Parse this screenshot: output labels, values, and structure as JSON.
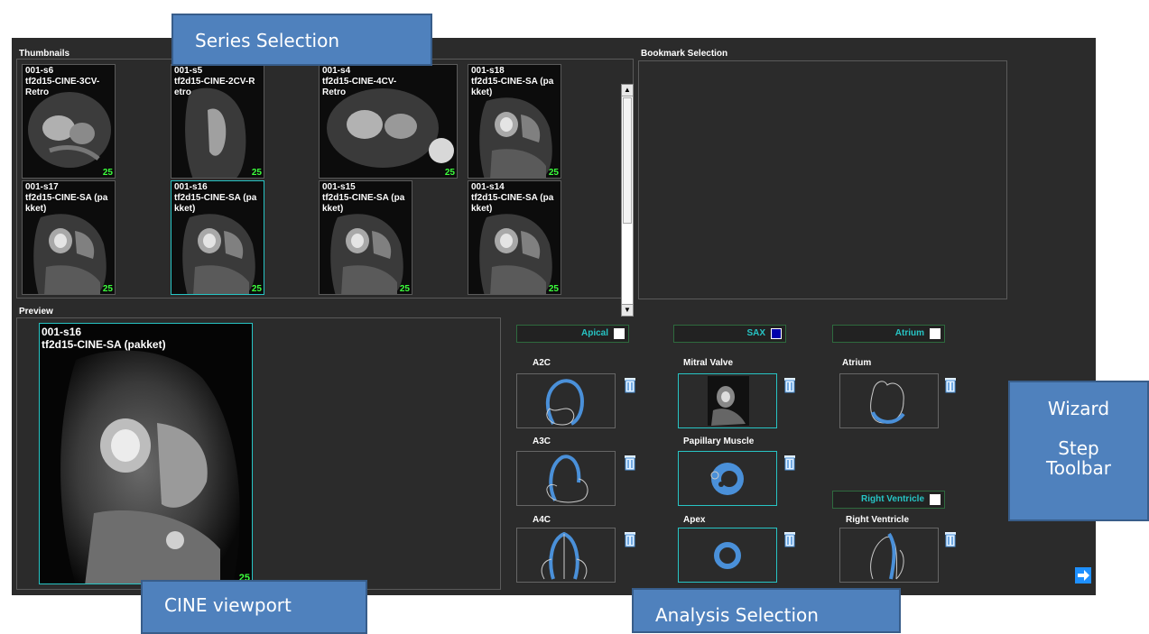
{
  "sections": {
    "thumbnails": "Thumbnails",
    "bookmark": "Bookmark Selection",
    "preview": "Preview"
  },
  "thumbnails": [
    {
      "name": "001-s6\ntf2d15-CINE-3CV-Retro",
      "count": "25",
      "view": "3cv"
    },
    {
      "name": "001-s5\ntf2d15-CINE-2CV-R\netro",
      "count": "25",
      "view": "2cv"
    },
    {
      "name": "001-s4\ntf2d15-CINE-4CV-Retro",
      "count": "25",
      "view": "4cv"
    },
    {
      "name": "001-s18\ntf2d15-CINE-SA (pa\nkket)",
      "count": "25",
      "view": "sa"
    },
    {
      "name": "001-s17\ntf2d15-CINE-SA (pa\nkket)",
      "count": "25",
      "view": "sa"
    },
    {
      "name": "001-s16\ntf2d15-CINE-SA (pa\nkket)",
      "count": "25",
      "view": "sa",
      "selected": true
    },
    {
      "name": "001-s15\ntf2d15-CINE-SA (pa\nkket)",
      "count": "25",
      "view": "sa"
    },
    {
      "name": "001-s14\ntf2d15-CINE-SA (pa\nkket)",
      "count": "25",
      "view": "sa"
    }
  ],
  "preview": {
    "title": "001-s16\ntf2d15-CINE-SA (pakket)",
    "count": "25"
  },
  "categories": {
    "apical": {
      "label": "Apical",
      "checked": false
    },
    "sax": {
      "label": "SAX",
      "checked": true
    },
    "atrium": {
      "label": "Atrium",
      "checked": false
    },
    "right_ventricle": {
      "label": "Right Ventricle",
      "checked": false
    }
  },
  "views": {
    "a2c": "A2C",
    "a3c": "A3C",
    "a4c": "A4C",
    "mitral": "Mitral Valve",
    "papillary": "Papillary Muscle",
    "apex": "Apex",
    "atrium": "Atrium",
    "rv": "Right Ventricle"
  },
  "callouts": {
    "series": "Series Selection",
    "cine": "CINE viewport",
    "analysis": "Analysis Selection",
    "wizard": "Wizard\n\nStep\nToolbar"
  },
  "colors": {
    "accent": "#27c4c4",
    "shape_blue": "#4a90d9",
    "count_green": "#3cff3c",
    "callout": "#4f81bd"
  },
  "icons": {
    "trash": "trash-icon",
    "next": "arrow-right-icon",
    "scroll_up": "scroll-up-icon",
    "scroll_down": "scroll-down-icon"
  }
}
